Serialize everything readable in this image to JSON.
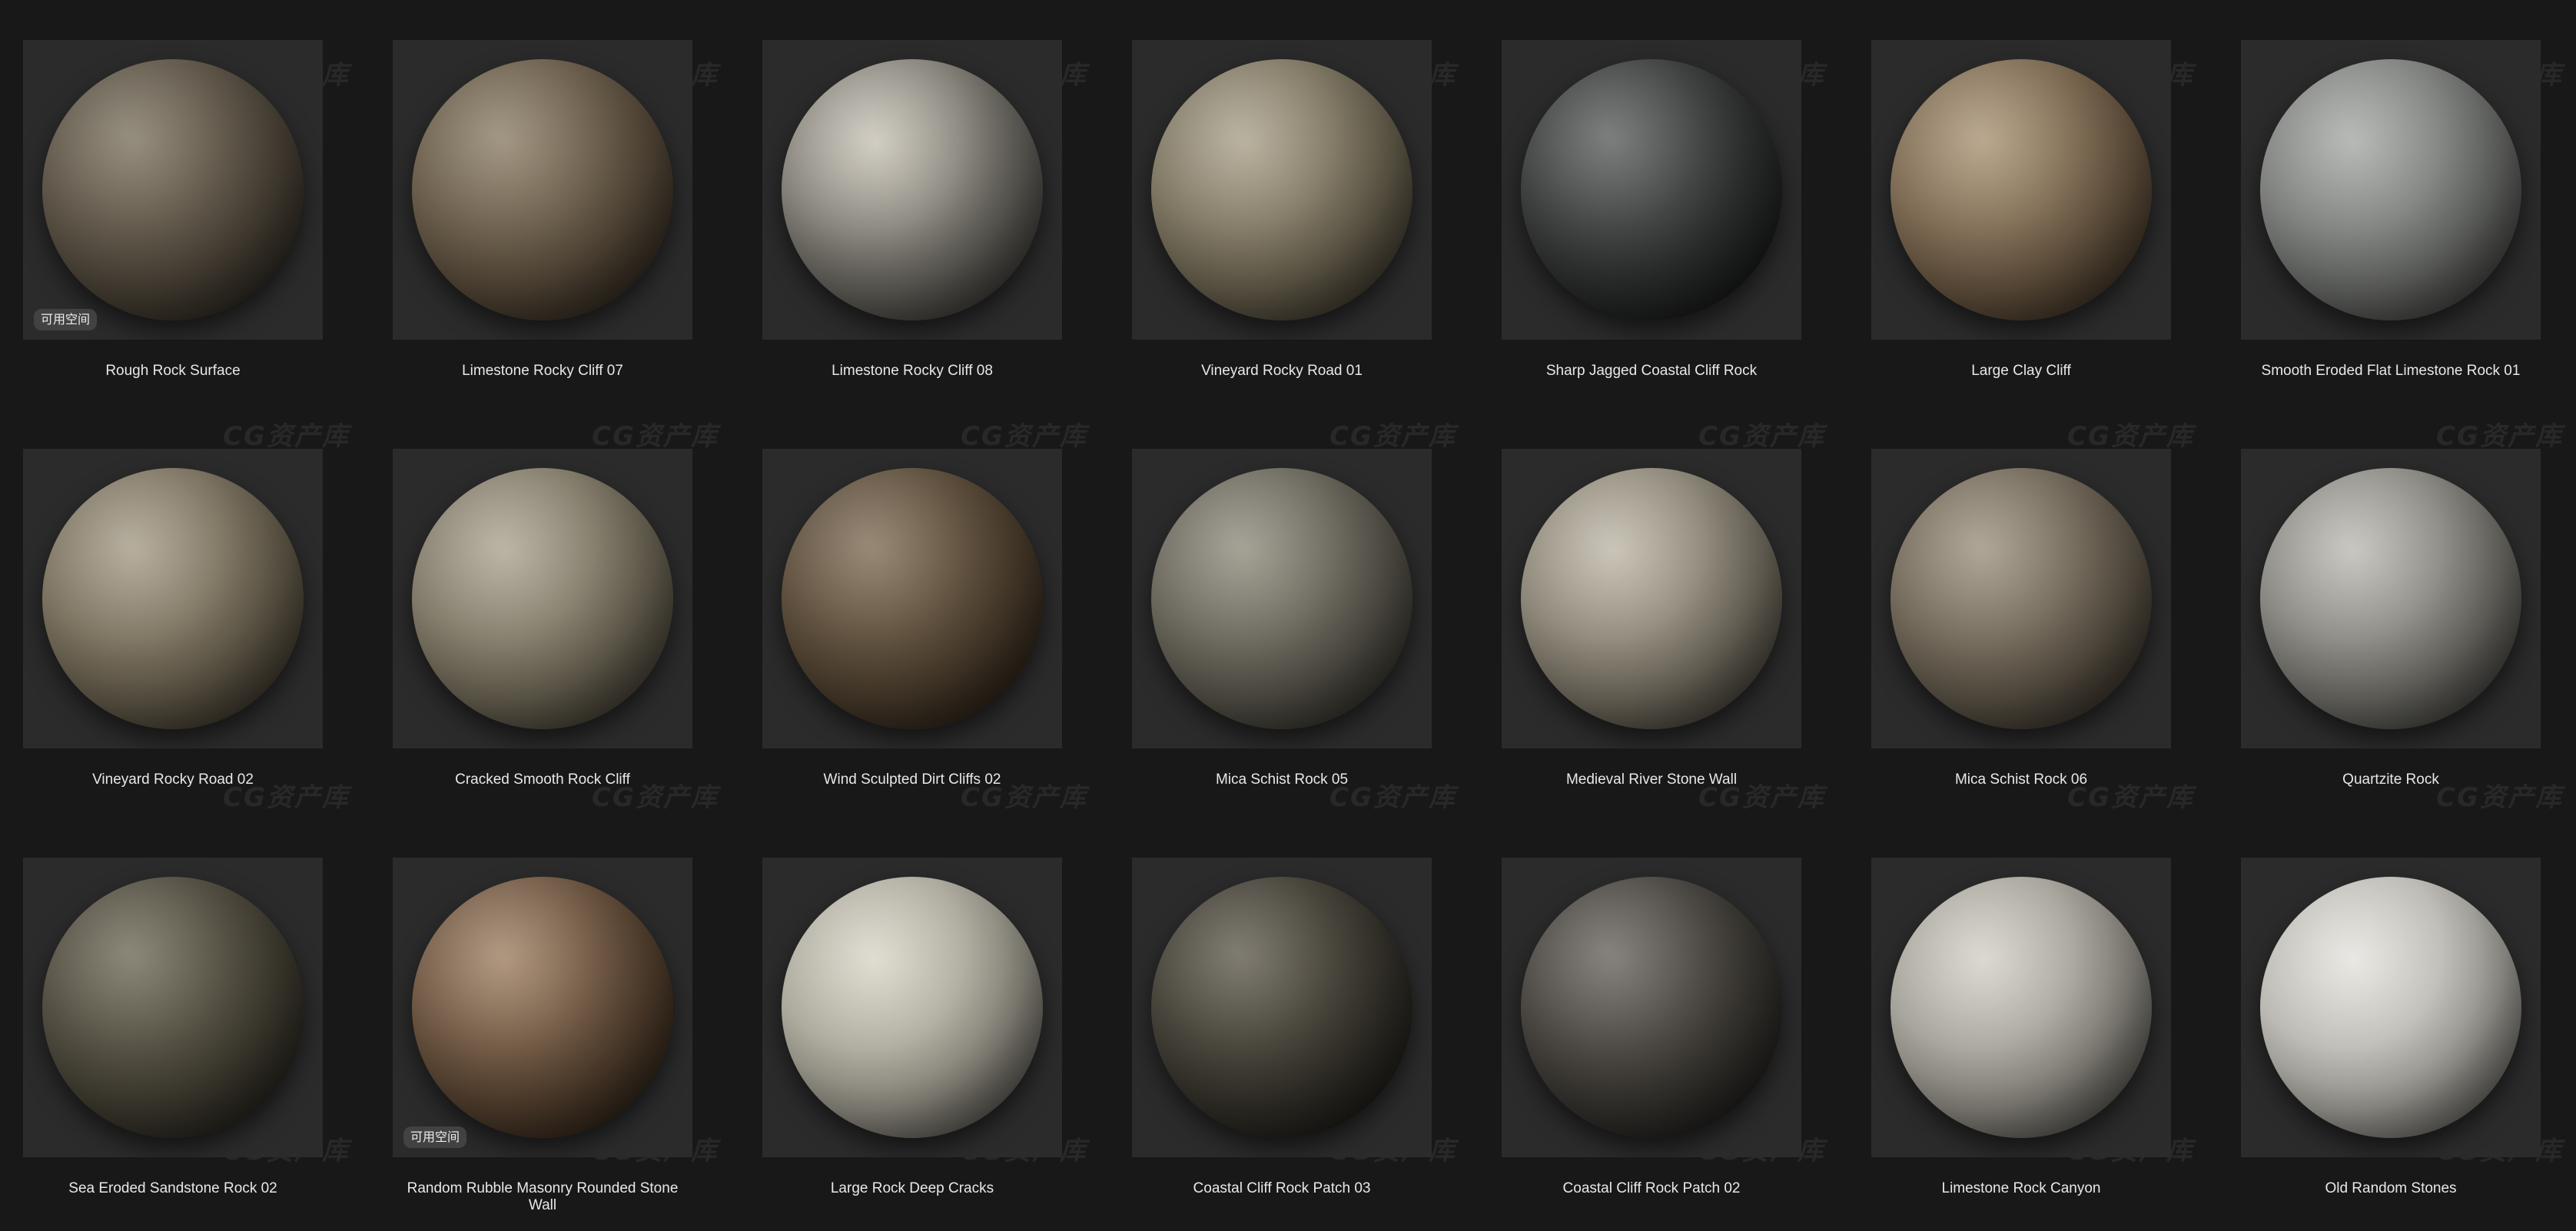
{
  "watermark_text": "CG资产库",
  "badge_text": "可用空间",
  "materials": [
    {
      "label": "Rough Rock Surface",
      "badge": true,
      "colors": [
        "#7a705c",
        "#4e463a",
        "#1e1a15"
      ]
    },
    {
      "label": "Limestone Rocky Cliff 07",
      "badge": false,
      "colors": [
        "#8a7c64",
        "#5a4d3c",
        "#1f1a14"
      ]
    },
    {
      "label": "Limestone Rocky Cliff 08",
      "badge": false,
      "colors": [
        "#c6c1b5",
        "#6d6a63",
        "#22211e"
      ]
    },
    {
      "label": "Vineyard Rocky Road 01",
      "badge": false,
      "colors": [
        "#a89f88",
        "#6d6552",
        "#2a261e"
      ]
    },
    {
      "label": "Sharp Jagged Coastal Cliff Rock",
      "badge": false,
      "colors": [
        "#5a5c5c",
        "#2e3030",
        "#0c0c0c"
      ]
    },
    {
      "label": "Large Clay Cliff",
      "badge": false,
      "colors": [
        "#a89172",
        "#6c5a44",
        "#2b2218"
      ]
    },
    {
      "label": "Smooth Eroded Flat Limestone Rock 01",
      "badge": false,
      "colors": [
        "#a6a8a5",
        "#6e706d",
        "#2c2d2b"
      ]
    },
    {
      "label": "Vineyard Rocky Road 02",
      "badge": false,
      "colors": [
        "#a49a85",
        "#6a614f",
        "#29251d"
      ]
    },
    {
      "label": "Cracked Smooth Rock Cliff",
      "badge": false,
      "colors": [
        "#aaa28f",
        "#716a59",
        "#2c2921"
      ]
    },
    {
      "label": "Wind Sculpted Dirt Cliffs 02",
      "badge": false,
      "colors": [
        "#7d6a52",
        "#4d3f2e",
        "#1b150f"
      ]
    },
    {
      "label": "Mica Schist Rock 05",
      "badge": false,
      "colors": [
        "#8e8a7c",
        "#5a574d",
        "#22211c"
      ]
    },
    {
      "label": "Medieval River Stone Wall",
      "badge": false,
      "colors": [
        "#bdb6a6",
        "#7b7567",
        "#2d2a25"
      ]
    },
    {
      "label": "Mica Schist Rock 06",
      "badge": false,
      "colors": [
        "#9a8f7c",
        "#62594b",
        "#25211b"
      ]
    },
    {
      "label": "Quartzite Rock",
      "badge": false,
      "colors": [
        "#bab9b2",
        "#77766f",
        "#2b2a27"
      ]
    },
    {
      "label": "Sea Eroded Sandstone Rock 02",
      "badge": false,
      "colors": [
        "#6d6755",
        "#433f33",
        "#171612"
      ]
    },
    {
      "label": "Random Rubble Masonry Rounded Stone Wall",
      "badge": true,
      "colors": [
        "#9c7d60",
        "#5a4532",
        "#1a130d"
      ]
    },
    {
      "label": "Large Rock Deep Cracks",
      "badge": false,
      "colors": [
        "#d8d4c6",
        "#9d9a8e",
        "#3a3833"
      ]
    },
    {
      "label": "Coastal Cliff Rock Patch 03",
      "badge": false,
      "colors": [
        "#5e594c",
        "#36332b",
        "#100f0d"
      ]
    },
    {
      "label": "Coastal Cliff Rock Patch 02",
      "badge": false,
      "colors": [
        "#66615a",
        "#3a3732",
        "#121110"
      ]
    },
    {
      "label": "Limestone Rock Canyon",
      "badge": false,
      "colors": [
        "#d2cfc6",
        "#97948b",
        "#393733"
      ]
    },
    {
      "label": "Old Random Stones",
      "badge": false,
      "colors": [
        "#e4e2dc",
        "#aeaca5",
        "#45443f"
      ]
    }
  ]
}
